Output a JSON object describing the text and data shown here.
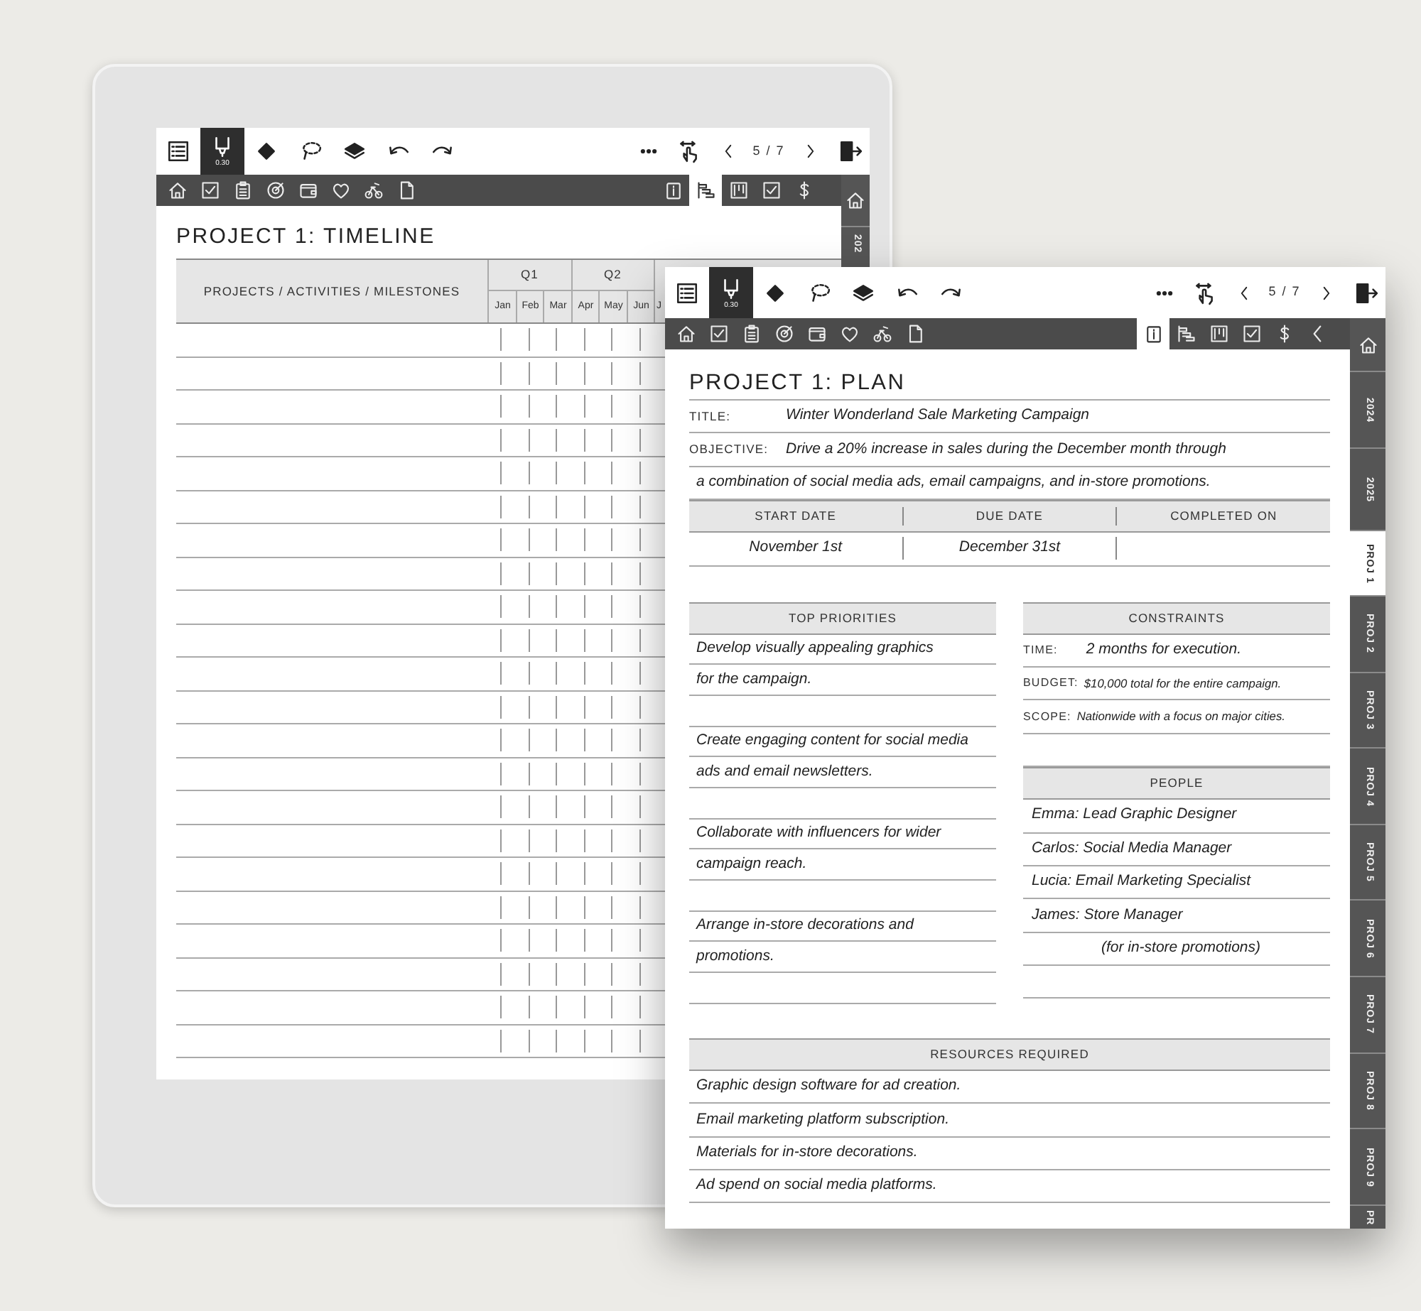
{
  "background_tablet": {
    "toolbar": {
      "tools": [
        {
          "kind": "list",
          "selected": false
        },
        {
          "kind": "pen",
          "selected": true,
          "badge": "0.30"
        },
        {
          "kind": "eraser",
          "selected": false
        },
        {
          "kind": "lasso",
          "selected": false
        },
        {
          "kind": "layers",
          "selected": false
        },
        {
          "kind": "undo",
          "selected": false
        },
        {
          "kind": "redo",
          "selected": false
        }
      ],
      "actions": [
        {
          "kind": "more"
        },
        {
          "kind": "touch"
        },
        {
          "kind": "prev"
        },
        {
          "kind": "page",
          "text": "5 / 7"
        },
        {
          "kind": "next"
        },
        {
          "kind": "exit"
        }
      ]
    },
    "nav_tabs": [
      {
        "kind": "home",
        "selected": false
      },
      {
        "kind": "check",
        "selected": false
      },
      {
        "kind": "clipboard",
        "selected": false
      },
      {
        "kind": "target",
        "selected": false
      },
      {
        "kind": "wallet",
        "selected": false
      },
      {
        "kind": "heart",
        "selected": false
      },
      {
        "kind": "bike",
        "selected": false
      },
      {
        "kind": "page",
        "selected": false
      }
    ],
    "nav_tabs_right": [
      {
        "kind": "info",
        "selected": false
      },
      {
        "kind": "gantt",
        "selected": true
      },
      {
        "kind": "board",
        "selected": false
      },
      {
        "kind": "check",
        "selected": false
      },
      {
        "kind": "dollar",
        "selected": false
      }
    ],
    "side_tabs": [
      {
        "kind": "home",
        "selected": false
      },
      {
        "kind": "label",
        "label": "202",
        "selected": false
      }
    ],
    "title": "PROJECT 1: TIMELINE",
    "timeline": {
      "label_column": "PROJECTS / ACTIVITIES / MILESTONES",
      "quarters": [
        "Q1",
        "Q2"
      ],
      "months": [
        "Jan",
        "Feb",
        "Mar",
        "Apr",
        "May",
        "Jun",
        "J"
      ]
    }
  },
  "foreground_page": {
    "toolbar": {
      "tools": [
        {
          "kind": "list",
          "selected": false
        },
        {
          "kind": "pen",
          "selected": true,
          "badge": "0.30"
        },
        {
          "kind": "eraser",
          "selected": false
        },
        {
          "kind": "lasso",
          "selected": false
        },
        {
          "kind": "layers",
          "selected": false
        },
        {
          "kind": "undo",
          "selected": false
        },
        {
          "kind": "redo",
          "selected": false
        }
      ],
      "actions": [
        {
          "kind": "more"
        },
        {
          "kind": "touch"
        },
        {
          "kind": "prev"
        },
        {
          "kind": "page",
          "text": "5 / 7"
        },
        {
          "kind": "next"
        },
        {
          "kind": "exit"
        }
      ]
    },
    "nav_tabs": [
      {
        "kind": "home",
        "selected": false
      },
      {
        "kind": "check",
        "selected": false
      },
      {
        "kind": "clipboard",
        "selected": false
      },
      {
        "kind": "target",
        "selected": false
      },
      {
        "kind": "wallet",
        "selected": false
      },
      {
        "kind": "heart",
        "selected": false
      },
      {
        "kind": "bike",
        "selected": false
      },
      {
        "kind": "page",
        "selected": false
      }
    ],
    "nav_tabs_right": [
      {
        "kind": "info",
        "selected": true
      },
      {
        "kind": "gantt",
        "selected": false
      },
      {
        "kind": "board",
        "selected": false
      },
      {
        "kind": "check",
        "selected": false
      },
      {
        "kind": "dollar",
        "selected": false
      },
      {
        "kind": "back",
        "selected": false
      }
    ],
    "side_tabs": [
      {
        "kind": "home",
        "selected": false
      },
      {
        "kind": "label",
        "label": "2024",
        "selected": false
      },
      {
        "kind": "label",
        "label": "2025",
        "selected": false
      },
      {
        "kind": "label",
        "label": "PROJ 1",
        "selected": true
      },
      {
        "kind": "label",
        "label": "PROJ 2",
        "selected": false
      },
      {
        "kind": "label",
        "label": "PROJ 3",
        "selected": false
      },
      {
        "kind": "label",
        "label": "PROJ 4",
        "selected": false
      },
      {
        "kind": "label",
        "label": "PROJ 5",
        "selected": false
      },
      {
        "kind": "label",
        "label": "PROJ 6",
        "selected": false
      },
      {
        "kind": "label",
        "label": "PROJ 7",
        "selected": false
      },
      {
        "kind": "label",
        "label": "PROJ 8",
        "selected": false
      },
      {
        "kind": "label",
        "label": "PROJ 9",
        "selected": false
      },
      {
        "kind": "label",
        "label": "PR",
        "selected": false
      }
    ],
    "title": "PROJECT 1: PLAN",
    "fields": [
      {
        "label": "TITLE:",
        "value": "Winter Wonderland Sale Marketing Campaign"
      },
      {
        "label": "OBJECTIVE:",
        "value": "Drive a 20% increase in sales during the December month through"
      }
    ],
    "objective_continued": "a combination of social media ads, email campaigns, and in-store promotions.",
    "dates": {
      "columns": [
        "START DATE",
        "DUE DATE",
        "COMPLETED ON"
      ],
      "values": [
        "November 1st",
        "December 31st"
      ]
    },
    "top_priorities": {
      "heading": "TOP PRIORITIES",
      "items": [
        {
          "lines": [
            "Develop visually appealing graphics",
            "for the campaign."
          ]
        },
        {
          "lines": [
            "Create engaging content for social media",
            "ads and email newsletters."
          ]
        },
        {
          "lines": [
            "Collaborate with influencers for wider",
            "campaign reach."
          ]
        },
        {
          "lines": [
            "Arrange in-store decorations and",
            "promotions."
          ]
        }
      ]
    },
    "constraints": {
      "heading": "CONSTRAINTS",
      "rows": [
        {
          "label": "TIME:",
          "value": "2 months for execution."
        },
        {
          "label": "BUDGET:",
          "value": "$10,000 total for the entire campaign."
        },
        {
          "label": "SCOPE:",
          "value": "Nationwide with a focus on major cities."
        }
      ]
    },
    "people": {
      "heading": "PEOPLE",
      "lines": [
        "Emma: Lead Graphic Designer",
        "Carlos: Social Media Manager",
        "Lucia: Email Marketing Specialist",
        "James: Store Manager",
        "(for in-store promotions)"
      ]
    },
    "resources": {
      "heading": "RESOURCES REQUIRED",
      "lines": [
        "Graphic design software for ad creation.",
        "Email marketing platform subscription.",
        "Materials for in-store decorations.",
        "Ad spend on social media platforms."
      ]
    }
  }
}
